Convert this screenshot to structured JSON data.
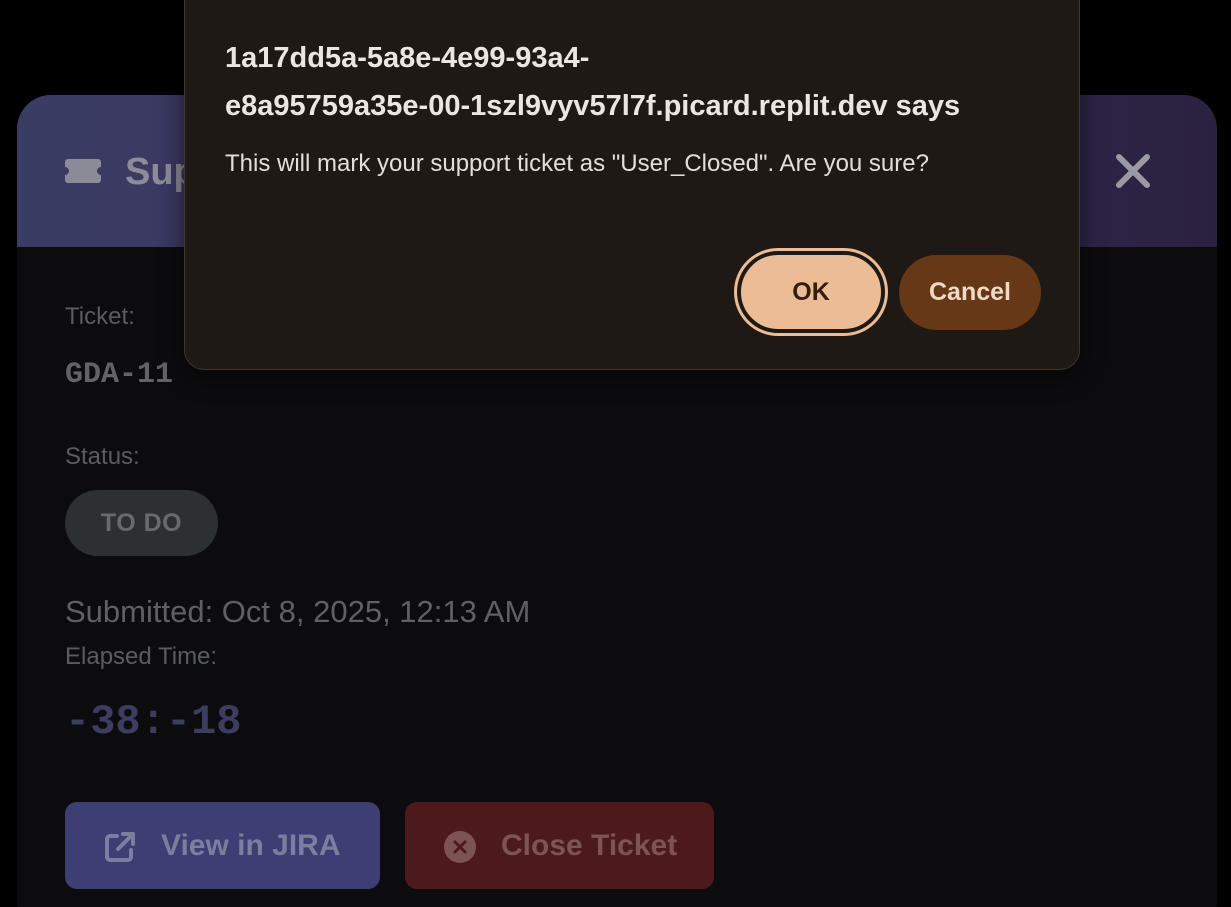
{
  "modal": {
    "title": "Sup",
    "ticket_label": "Ticket:",
    "ticket_id": "GDA-11",
    "status_label": "Status:",
    "status_value": "TO DO",
    "submitted": "Submitted: Oct 8, 2025, 12:13 AM",
    "elapsed_label": "Elapsed Time:",
    "elapsed_value": "-38:-18",
    "view_jira_label": "View in JIRA",
    "close_ticket_label": "Close Ticket"
  },
  "dialog": {
    "title_line1": "1a17dd5a-5a8e-4e99-93a4-",
    "title_line2": "e8a95759a35e-00-1szl9vyv57l7f.picard.replit.dev says",
    "message": "This will mark your support ticket as \"User_Closed\". Are you sure?",
    "ok_label": "OK",
    "cancel_label": "Cancel"
  },
  "colors": {
    "header_gradient_start": "#3b3c64",
    "header_gradient_end": "#2b213f",
    "jira_button": "#3d3e73",
    "close_button": "#4c1a1d",
    "dialog_background": "#1f1916",
    "ok_button": "#ebbc96",
    "cancel_button": "#673817"
  },
  "icons": {
    "header": "ticket-icon",
    "close": "close-icon",
    "jira": "external-link-icon",
    "close_ticket": "x-circle-icon"
  }
}
